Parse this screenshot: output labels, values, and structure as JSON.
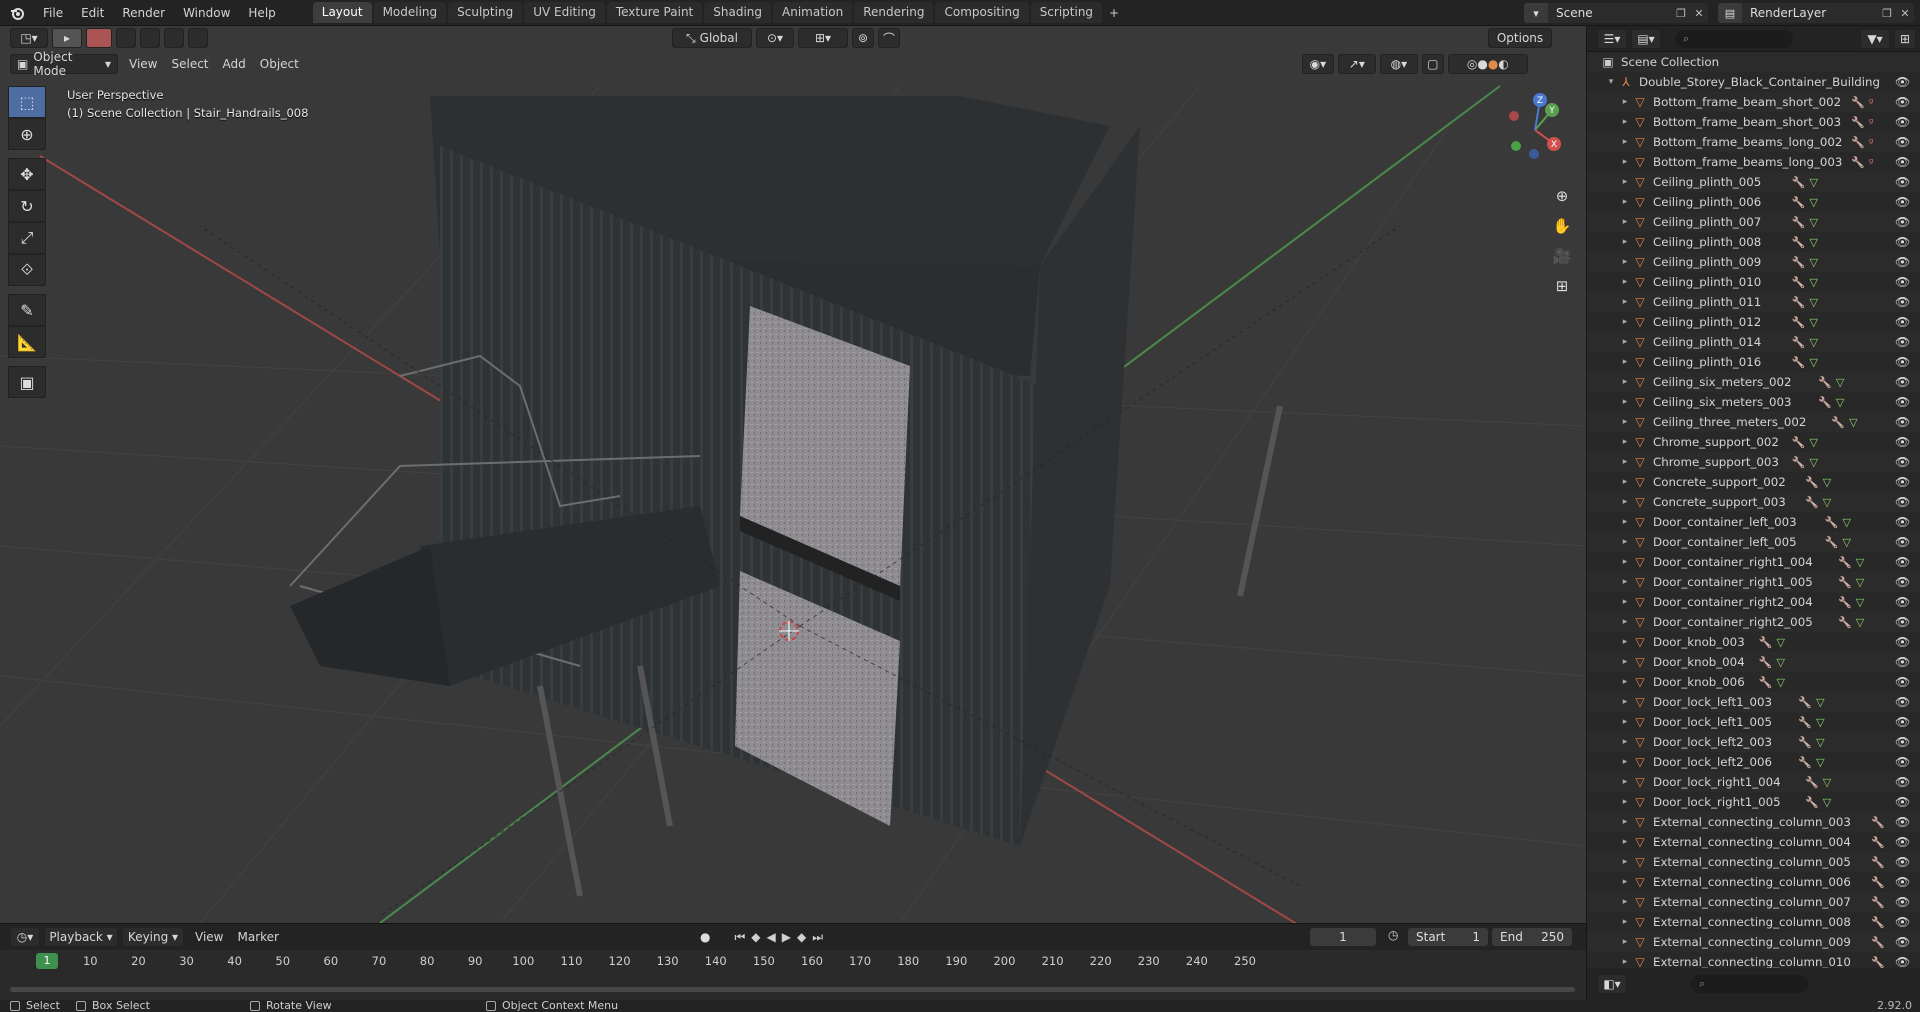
{
  "topbar": {
    "menus": [
      "File",
      "Edit",
      "Render",
      "Window",
      "Help"
    ],
    "tabs": [
      "Layout",
      "Modeling",
      "Sculpting",
      "UV Editing",
      "Texture Paint",
      "Shading",
      "Animation",
      "Rendering",
      "Compositing",
      "Scripting"
    ],
    "active_tab": "Layout",
    "tab_add": "+",
    "scene_name": "Scene",
    "render_layer": "RenderLayer"
  },
  "viewport": {
    "mode": "Object Mode",
    "menus": [
      "View",
      "Select",
      "Add",
      "Object"
    ],
    "transform_orientation": "Global",
    "options_label": "Options",
    "perspective_label": "User Perspective",
    "collection_label": "(1) Scene Collection | Stair_Handrails_008",
    "gizmo": {
      "x": "X",
      "y": "Y",
      "z": "Z"
    },
    "nav_icons": [
      "zoom-icon",
      "hand-icon",
      "camera-icon",
      "grid-icon"
    ]
  },
  "timeline": {
    "menus": [
      "Playback",
      "Keying",
      "View",
      "Marker"
    ],
    "current_frame": "1",
    "start_label": "Start",
    "start_value": "1",
    "end_label": "End",
    "end_value": "250",
    "ticks": [
      "10",
      "20",
      "30",
      "40",
      "50",
      "60",
      "70",
      "80",
      "90",
      "100",
      "110",
      "120",
      "130",
      "140",
      "150",
      "160",
      "170",
      "180",
      "190",
      "200",
      "210",
      "220",
      "230",
      "240",
      "250"
    ],
    "cursor_frame": "1"
  },
  "statusbar": {
    "select": "Select",
    "box_select": "Box Select",
    "rotate": "Rotate View",
    "context": "Object Context Menu",
    "version": "2.92.0"
  },
  "outliner": {
    "collection": "Scene Collection",
    "root": "Double_Storey_Black_Container_Building",
    "items": [
      {
        "name": "Bottom_frame_beam_short_002",
        "mods": "wrench-bone"
      },
      {
        "name": "Bottom_frame_beam_short_003",
        "mods": "wrench-bone"
      },
      {
        "name": "Bottom_frame_beams_long_002",
        "mods": "wrench-bone"
      },
      {
        "name": "Bottom_frame_beams_long_003",
        "mods": "wrench-bone"
      },
      {
        "name": "Ceiling_plinth_005",
        "mods": "wrench-mesh"
      },
      {
        "name": "Ceiling_plinth_006",
        "mods": "wrench-mesh"
      },
      {
        "name": "Ceiling_plinth_007",
        "mods": "wrench-mesh"
      },
      {
        "name": "Ceiling_plinth_008",
        "mods": "wrench-mesh"
      },
      {
        "name": "Ceiling_plinth_009",
        "mods": "wrench-mesh"
      },
      {
        "name": "Ceiling_plinth_010",
        "mods": "wrench-mesh"
      },
      {
        "name": "Ceiling_plinth_011",
        "mods": "wrench-mesh"
      },
      {
        "name": "Ceiling_plinth_012",
        "mods": "wrench-mesh"
      },
      {
        "name": "Ceiling_plinth_014",
        "mods": "wrench-mesh"
      },
      {
        "name": "Ceiling_plinth_016",
        "mods": "wrench-mesh"
      },
      {
        "name": "Ceiling_six_meters_002",
        "mods": "wrench-mesh"
      },
      {
        "name": "Ceiling_six_meters_003",
        "mods": "wrench-mesh"
      },
      {
        "name": "Ceiling_three_meters_002",
        "mods": "wrench-mesh"
      },
      {
        "name": "Chrome_support_002",
        "mods": "wrench-mesh"
      },
      {
        "name": "Chrome_support_003",
        "mods": "wrench-mesh"
      },
      {
        "name": "Concrete_support_002",
        "mods": "wrench-mesh"
      },
      {
        "name": "Concrete_support_003",
        "mods": "wrench-mesh"
      },
      {
        "name": "Door_container_left_003",
        "mods": "wrench-mesh"
      },
      {
        "name": "Door_container_left_005",
        "mods": "wrench-mesh"
      },
      {
        "name": "Door_container_right1_004",
        "mods": "wrench-mesh"
      },
      {
        "name": "Door_container_right1_005",
        "mods": "wrench-mesh"
      },
      {
        "name": "Door_container_right2_004",
        "mods": "wrench-mesh"
      },
      {
        "name": "Door_container_right2_005",
        "mods": "wrench-mesh"
      },
      {
        "name": "Door_knob_003",
        "mods": "wrench-mesh"
      },
      {
        "name": "Door_knob_004",
        "mods": "wrench-mesh"
      },
      {
        "name": "Door_knob_006",
        "mods": "wrench-mesh"
      },
      {
        "name": "Door_lock_left1_003",
        "mods": "wrench-mesh"
      },
      {
        "name": "Door_lock_left1_005",
        "mods": "wrench-mesh"
      },
      {
        "name": "Door_lock_left2_003",
        "mods": "wrench-mesh"
      },
      {
        "name": "Door_lock_left2_006",
        "mods": "wrench-mesh"
      },
      {
        "name": "Door_lock_right1_004",
        "mods": "wrench-mesh"
      },
      {
        "name": "Door_lock_right1_005",
        "mods": "wrench-mesh"
      },
      {
        "name": "External_connecting_column_003",
        "mods": "wrench"
      },
      {
        "name": "External_connecting_column_004",
        "mods": "wrench"
      },
      {
        "name": "External_connecting_column_005",
        "mods": "wrench"
      },
      {
        "name": "External_connecting_column_006",
        "mods": "wrench"
      },
      {
        "name": "External_connecting_column_007",
        "mods": "wrench"
      },
      {
        "name": "External_connecting_column_008",
        "mods": "wrench"
      },
      {
        "name": "External_connecting_column_009",
        "mods": "wrench"
      },
      {
        "name": "External_connecting_column_010",
        "mods": "wrench"
      }
    ]
  },
  "colors": {
    "accent": "#4d6da3",
    "mesh_orange": "#e8884b",
    "frame_green": "#3f8f4f",
    "axis_red": "#d05050",
    "axis_green": "#5aa050"
  }
}
